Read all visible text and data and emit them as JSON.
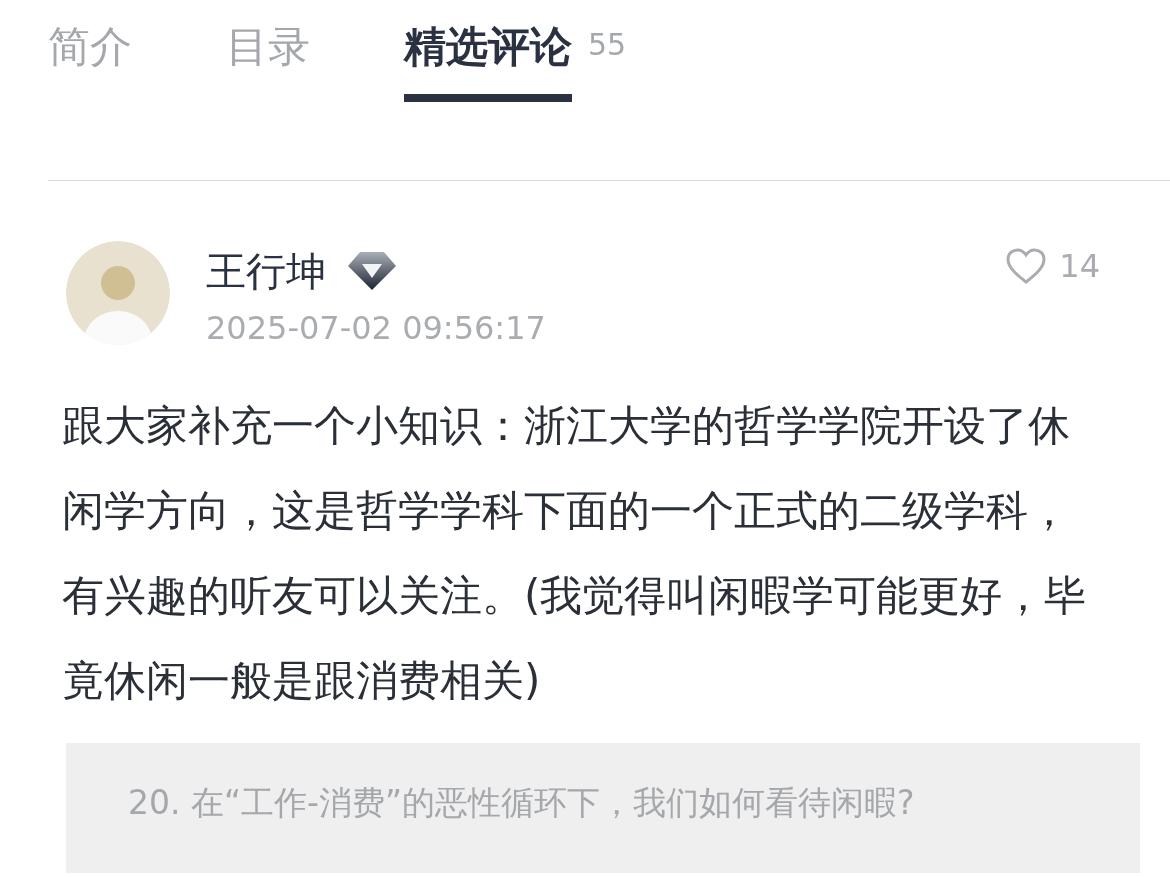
{
  "tabs": [
    {
      "label": "简介",
      "selected": false
    },
    {
      "label": "目录",
      "selected": false
    },
    {
      "label": "精选评论",
      "selected": true,
      "count": "55"
    }
  ],
  "comment": {
    "author": "王行坤",
    "date": "2025-07-02 09:56:17",
    "likes": "14",
    "liked": false,
    "text": "跟大家补充一个小知识：浙江大学的哲学学院开设了休闲学方向，这是哲学学科下面的一个正式的二级学科，有兴趣的听友可以关注。(我觉得叫闲暇学可能更好，毕竟休闲一般是跟消费相关)",
    "quote": "20. 在“工作-消费”的恶性循环下，我们如何看待闲暇?"
  }
}
